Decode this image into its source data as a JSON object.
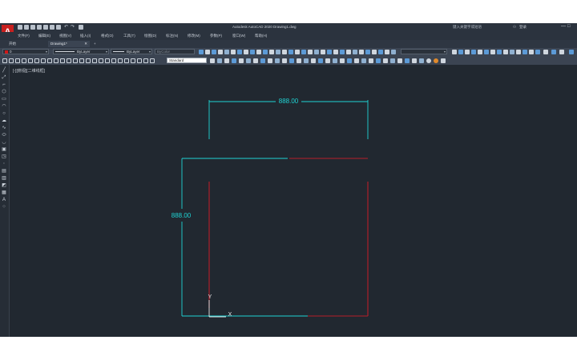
{
  "app": {
    "title": "Autodesk AutoCAD 2020    Drawing1.dwg",
    "logo_letter": "A",
    "search_placeholder": "键入关键字或短语",
    "user_label": "登录",
    "window_controls": [
      "—",
      "□",
      "✕"
    ]
  },
  "menu": [
    "文件(F)",
    "编辑(E)",
    "视图(V)",
    "插入(I)",
    "格式(O)",
    "工具(T)",
    "绘图(D)",
    "标注(N)",
    "修改(M)",
    "参数(P)",
    "窗口(W)",
    "帮助(H)"
  ],
  "tabs": [
    {
      "label": "开始"
    },
    {
      "label": "Drawing1*",
      "active": true
    }
  ],
  "tab_add": "+",
  "tab_close": "✕",
  "toolbar": {
    "layer_value": "0",
    "linetype_value": "ByLayer",
    "lineweight_value": "ByLayer",
    "color_value": "ByColor",
    "textstyle_value": "Standard"
  },
  "viewport_label": "[-][俯视][二维线框]",
  "drawing": {
    "dim_horizontal": "888.00",
    "dim_vertical": "888.00",
    "ucs_y": "Y",
    "ucs_x": "X",
    "colors": {
      "cyan": "#1fd4d4",
      "red": "#b81e2a",
      "white": "#e8e8e8"
    }
  },
  "left_tools": [
    "line-icon",
    "polyline-icon",
    "circle-icon",
    "arc-icon",
    "rectangle-icon",
    "polygon-icon",
    "ellipse-icon",
    "spline-icon",
    "hatch-icon",
    "block-icon",
    "table-icon",
    "mtext-icon"
  ]
}
